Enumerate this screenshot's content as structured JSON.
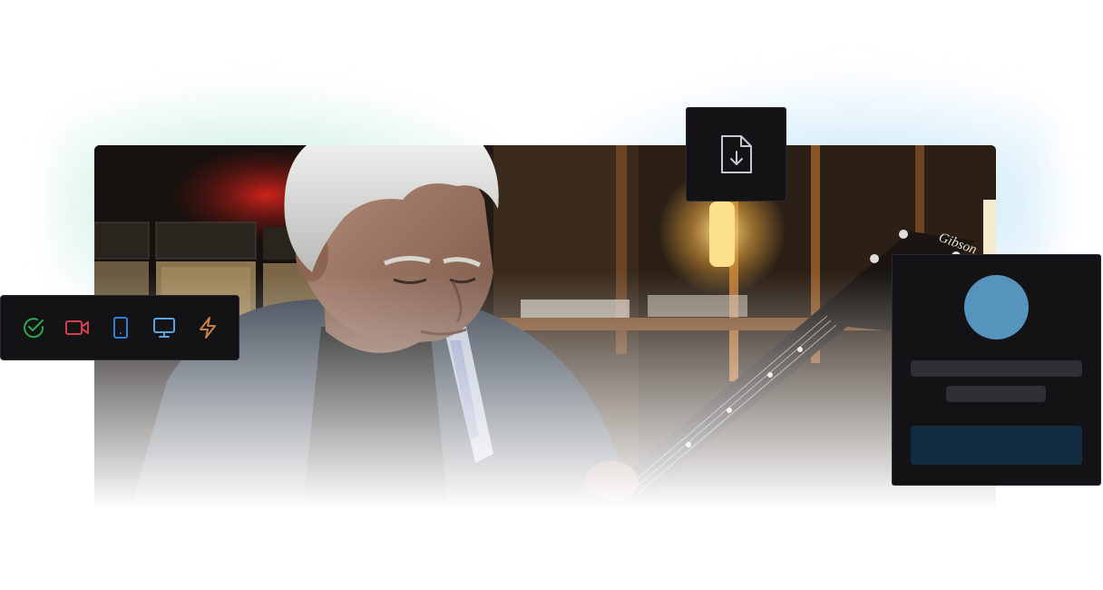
{
  "colors": {
    "check_icon": "#2fa84f",
    "video_icon": "#d2404c",
    "tablet_icon": "#2f7fd9",
    "monitor_icon": "#5ba3e0",
    "bolt_icon": "#c5804a",
    "download_icon": "#c9c9cf",
    "avatar": "#5794bd",
    "profile_button": "#112c40",
    "card_bg": "#131316"
  },
  "toolbar": {
    "icons": [
      "check-circle-icon",
      "video-camera-icon",
      "tablet-icon",
      "monitor-icon",
      "lightning-bolt-icon"
    ]
  },
  "download": {
    "icon": "file-download-icon"
  },
  "hero": {
    "guitar_brand": "Gibson"
  }
}
